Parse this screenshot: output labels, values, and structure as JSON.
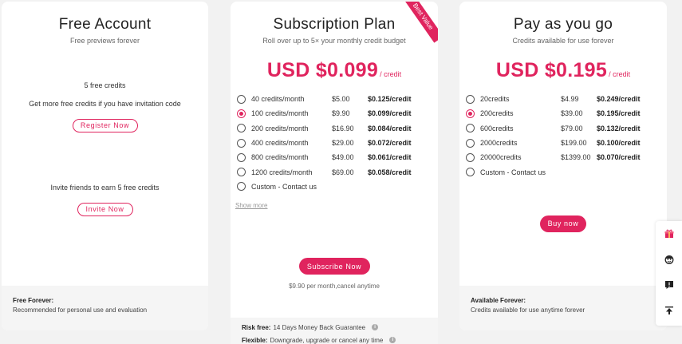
{
  "free": {
    "title": "Free Account",
    "subtitle": "Free previews forever",
    "credits_line": "5 free credits",
    "invite_code_line": "Get more free credits if you have invitation code",
    "register_label": "Register Now",
    "invite_line": "Invite friends to earn 5 free credits",
    "invite_label": "Invite Now",
    "footer_title": "Free Forever:",
    "footer_desc": "Recommended for personal use and evaluation"
  },
  "subscription": {
    "title": "Subscription Plan",
    "subtitle": "Roll over up to 5× your monthly credit budget",
    "ribbon": "Best Value",
    "price": "USD $0.099",
    "price_unit": "/ credit",
    "options": [
      {
        "label": "40 credits/month",
        "price": "$5.00",
        "per": "$0.125/credit",
        "selected": false
      },
      {
        "label": "100 credits/month",
        "price": "$9.90",
        "per": "$0.099/credit",
        "selected": true
      },
      {
        "label": "200 credits/month",
        "price": "$16.90",
        "per": "$0.084/credit",
        "selected": false
      },
      {
        "label": "400 credits/month",
        "price": "$29.00",
        "per": "$0.072/credit",
        "selected": false
      },
      {
        "label": "800 credits/month",
        "price": "$49.00",
        "per": "$0.061/credit",
        "selected": false
      },
      {
        "label": "1200 credits/month",
        "price": "$69.00",
        "per": "$0.058/credit",
        "selected": false
      },
      {
        "label": "Custom - Contact us",
        "price": "",
        "per": "",
        "selected": false
      }
    ],
    "show_more": "Show more",
    "button_label": "Subscribe Now",
    "billing_note": "$9.90 per month,cancel anytime",
    "risk_title": "Risk free:",
    "risk_text": "14 Days Money Back Guarantee",
    "flex_title": "Flexible:",
    "flex_text": "Downgrade, upgrade or cancel any time"
  },
  "payg": {
    "title": "Pay as you go",
    "subtitle": "Credits available for use forever",
    "price": "USD $0.195",
    "price_unit": "/ credit",
    "options": [
      {
        "label": "20credits",
        "price": "$4.99",
        "per": "$0.249/credit",
        "selected": false
      },
      {
        "label": "200credits",
        "price": "$39.00",
        "per": "$0.195/credit",
        "selected": true
      },
      {
        "label": "600credits",
        "price": "$79.00",
        "per": "$0.132/credit",
        "selected": false
      },
      {
        "label": "2000credits",
        "price": "$199.00",
        "per": "$0.100/credit",
        "selected": false
      },
      {
        "label": "20000credits",
        "price": "$1399.00",
        "per": "$0.070/credit",
        "selected": false
      },
      {
        "label": "Custom - Contact us",
        "price": "",
        "per": "",
        "selected": false
      }
    ],
    "button_label": "Buy now",
    "footer_title": "Available Forever:",
    "footer_desc": "Credits available for use anytime forever"
  },
  "sidebar_icons": [
    "gift-icon",
    "support-face-icon",
    "feedback-icon",
    "back-to-top-icon"
  ],
  "accent": "#e0245e"
}
